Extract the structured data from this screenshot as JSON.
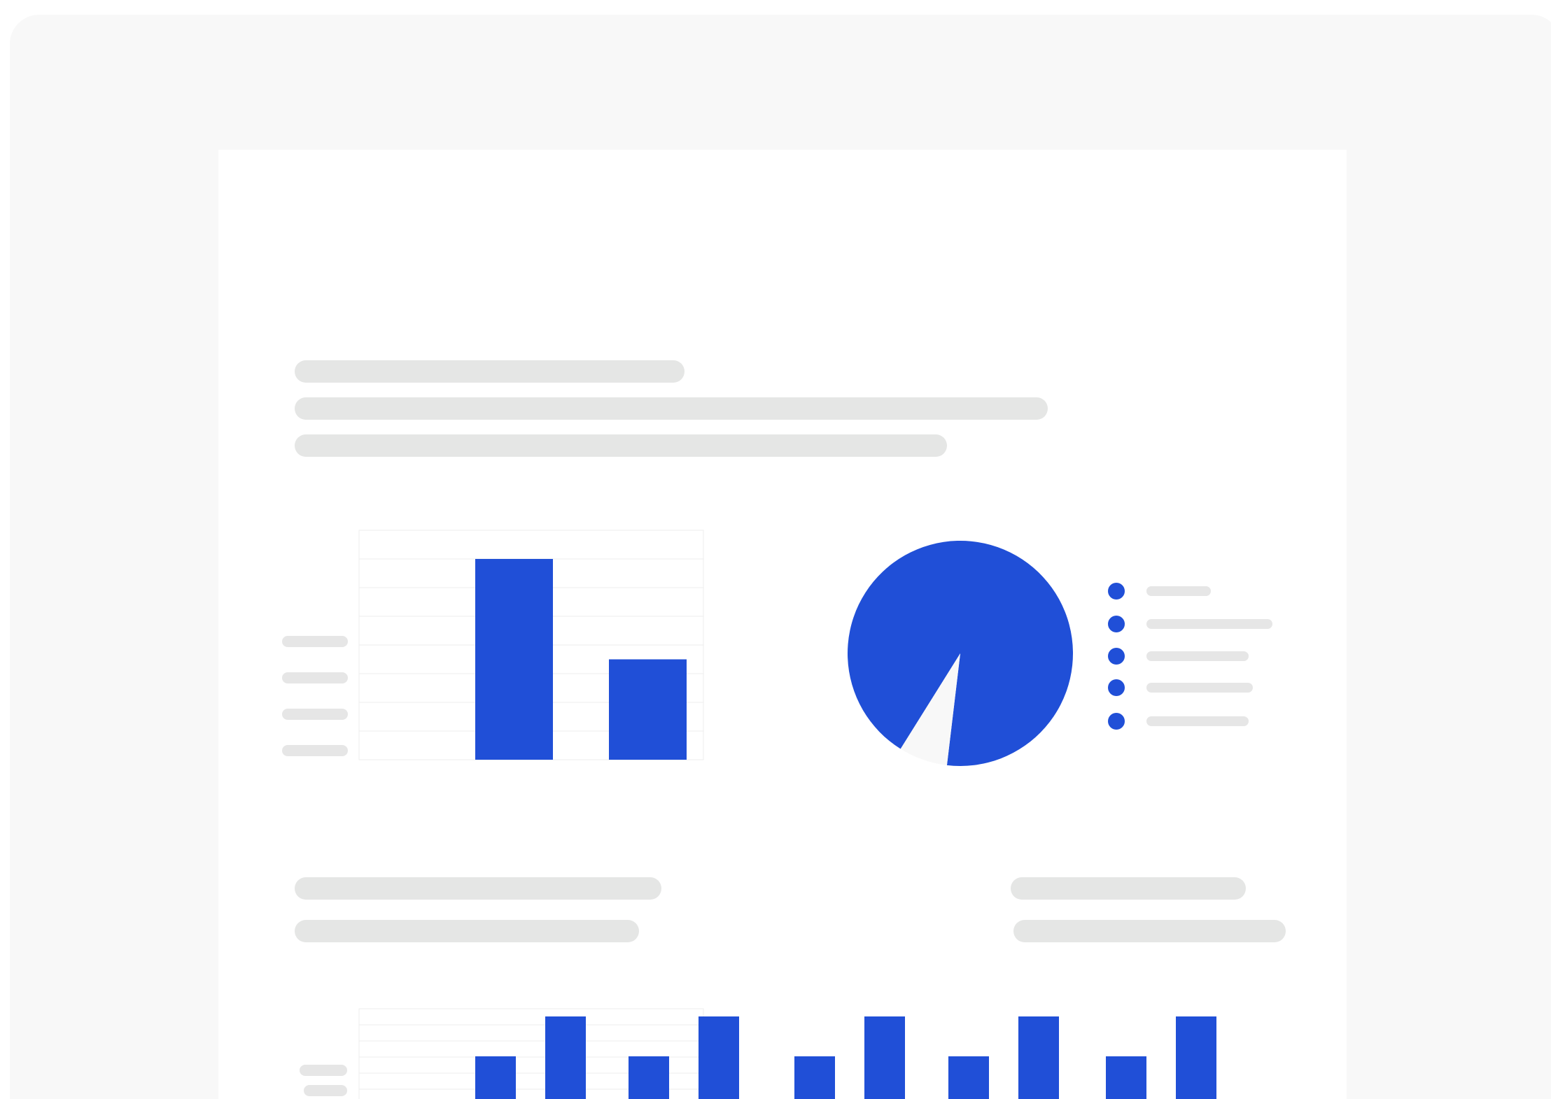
{
  "theme": {
    "accent": "#204fd7",
    "skeleton": "#e5e6e5",
    "page_background": "#f8f8f8",
    "gridline": "#eeeeee"
  },
  "chart_data": [
    {
      "type": "bar",
      "categories": [
        "",
        ""
      ],
      "values": [
        7,
        3.5
      ],
      "ylim": [
        0,
        8
      ],
      "grid": true,
      "title": "",
      "xlabel": "",
      "ylabel": "",
      "legend": "left"
    },
    {
      "type": "pie",
      "values": [
        93,
        7
      ],
      "colors": [
        "#204fd7",
        "#f8f8f8"
      ],
      "legend": "right",
      "legend_entries": 5
    },
    {
      "type": "bar",
      "categories": [
        "",
        "",
        "",
        "",
        "",
        "",
        "",
        "",
        "",
        "",
        "",
        ""
      ],
      "values": [
        2,
        4,
        2,
        4,
        2,
        4,
        2,
        4,
        2,
        4
      ],
      "grid": true,
      "title": ""
    }
  ]
}
